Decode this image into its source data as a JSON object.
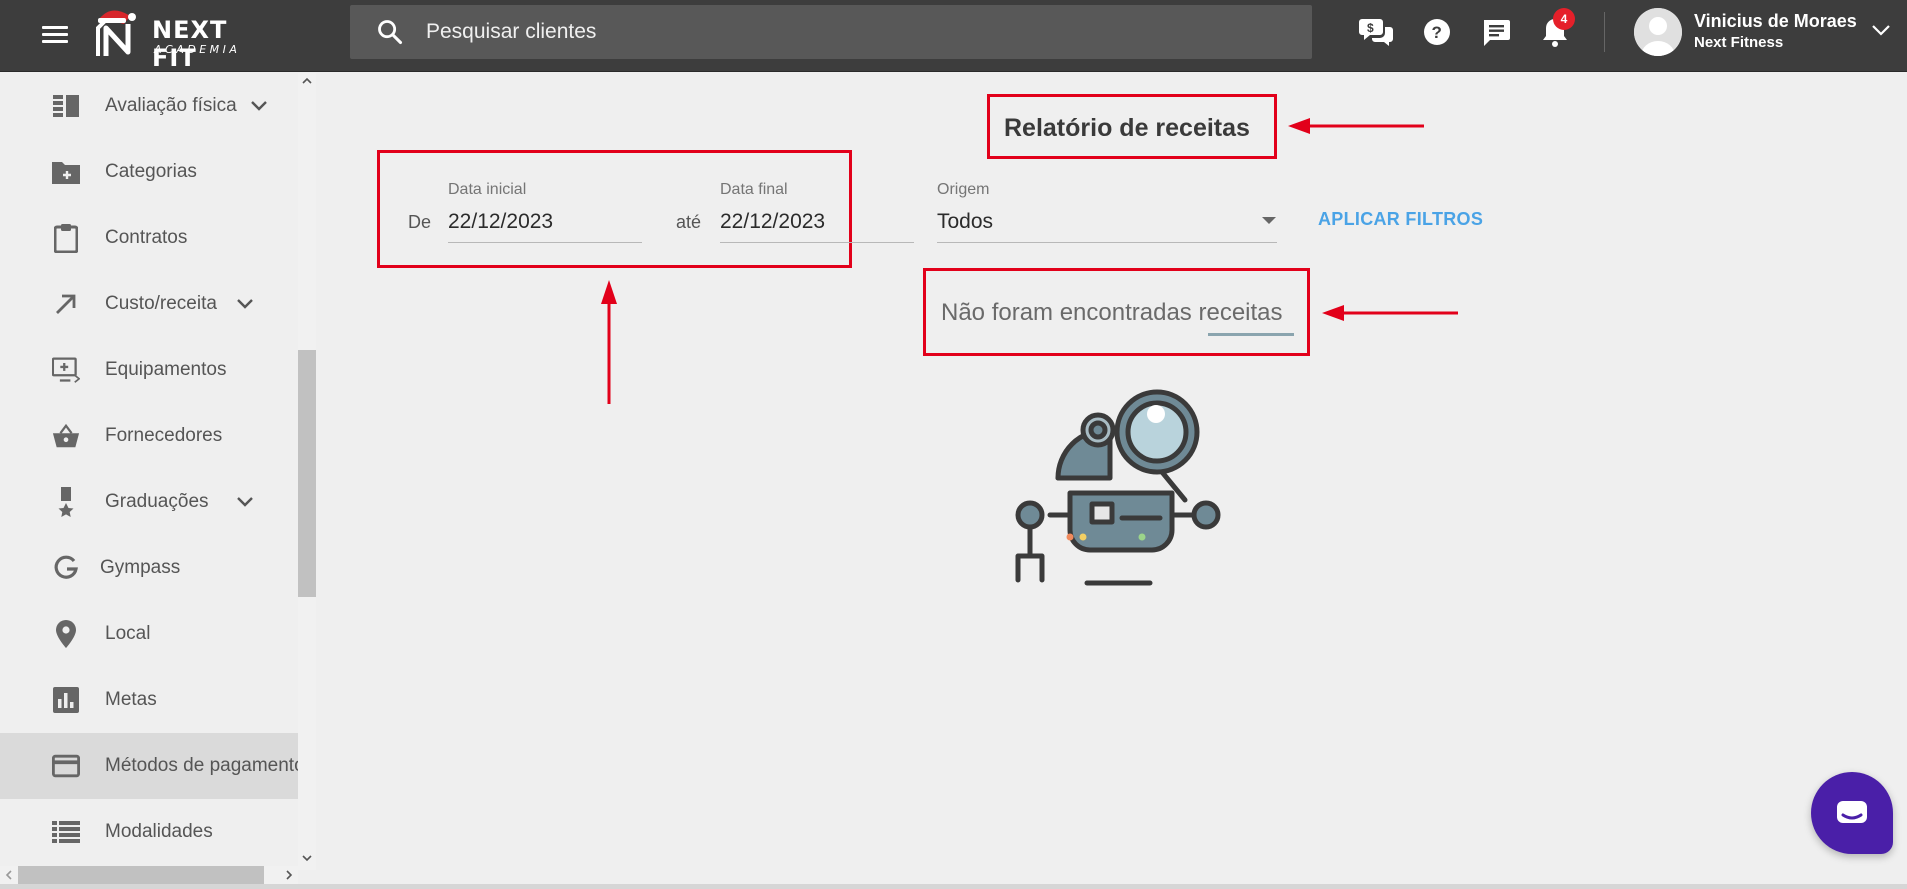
{
  "header": {
    "logo_title": "NEXT FIT",
    "logo_subtitle": "ACADEMIA",
    "search_placeholder": "Pesquisar clientes",
    "notification_count": "4",
    "user_name": "Vinicius de Moraes",
    "user_org": "Next Fitness",
    "icons": [
      "menu-icon",
      "search-icon",
      "finance-chat-icon",
      "help-icon",
      "message-icon",
      "bell-icon",
      "chevron-down-icon"
    ]
  },
  "sidebar": {
    "items": [
      {
        "label": "Avaliação física",
        "icon": "evaluation-icon",
        "has_chevron": true
      },
      {
        "label": "Categorias",
        "icon": "folder-plus-icon",
        "has_chevron": false
      },
      {
        "label": "Contratos",
        "icon": "clipboard-icon",
        "has_chevron": false
      },
      {
        "label": "Custo/receita",
        "icon": "arrow-up-right-icon",
        "has_chevron": true
      },
      {
        "label": "Equipamentos",
        "icon": "monitor-plus-icon",
        "has_chevron": false
      },
      {
        "label": "Fornecedores",
        "icon": "basket-icon",
        "has_chevron": false
      },
      {
        "label": "Graduações",
        "icon": "medal-icon",
        "has_chevron": true
      },
      {
        "label": "Gympass",
        "icon": "g-icon",
        "has_chevron": false
      },
      {
        "label": "Local",
        "icon": "location-pin-icon",
        "has_chevron": false
      },
      {
        "label": "Metas",
        "icon": "bar-chart-icon",
        "has_chevron": false
      },
      {
        "label": "Métodos de pagamento",
        "icon": "credit-card-icon",
        "has_chevron": false,
        "active": true
      },
      {
        "label": "Modalidades",
        "icon": "list-icon",
        "has_chevron": false
      }
    ]
  },
  "report": {
    "title": "Relatório de receitas",
    "from_label": "De",
    "until_label": "até",
    "start_date_label": "Data inicial",
    "start_date_value": "22/12/2023",
    "end_date_label": "Data final",
    "end_date_value": "22/12/2023",
    "origin_label": "Origem",
    "origin_value": "Todos",
    "apply_button": "APLICAR FILTROS",
    "empty_message": "Não foram encontradas receitas"
  },
  "colors": {
    "topbar": "#3d3d3d",
    "accent": "#4aa3e6",
    "annotation_red": "#e2001a",
    "badge": "#e5202a",
    "chat_fab": "#4a1fa8"
  }
}
